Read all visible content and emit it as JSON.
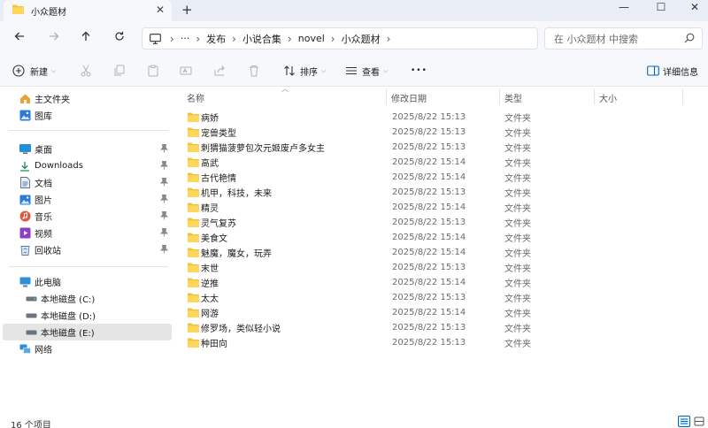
{
  "window": {
    "tab_title": "小众题材",
    "tab_close": "✕",
    "new_tab": "+",
    "minimize": "—",
    "maximize": "☐",
    "close": "✕"
  },
  "address": {
    "more": "···",
    "crumbs": [
      "发布",
      "小说合集",
      "novel",
      "小众题材"
    ],
    "separator": "›"
  },
  "search": {
    "placeholder": "在 小众题材 中搜索"
  },
  "toolbar": {
    "new_label": "新建",
    "sort_label": "排序",
    "view_label": "查看",
    "more_label": "•••",
    "details_label": "详细信息"
  },
  "sidebar": {
    "groups": [
      [
        {
          "label": "主文件夹",
          "icon": "home-icon"
        },
        {
          "label": "图库",
          "icon": "gallery-icon"
        }
      ],
      [
        {
          "label": "桌面",
          "icon": "desktop-icon",
          "pinned": true
        },
        {
          "label": "Downloads",
          "icon": "download-icon",
          "pinned": true
        },
        {
          "label": "文档",
          "icon": "documents-icon",
          "pinned": true
        },
        {
          "label": "图片",
          "icon": "pictures-icon",
          "pinned": true
        },
        {
          "label": "音乐",
          "icon": "music-icon",
          "pinned": true
        },
        {
          "label": "视频",
          "icon": "videos-icon",
          "pinned": true
        },
        {
          "label": "回收站",
          "icon": "recycle-bin-icon",
          "pinned": true
        }
      ],
      [
        {
          "label": "此电脑",
          "icon": "this-pc-icon"
        },
        {
          "label": "本地磁盘 (C:)",
          "icon": "drive-icon"
        },
        {
          "label": "本地磁盘 (D:)",
          "icon": "drive-icon"
        },
        {
          "label": "本地磁盘 (E:)",
          "icon": "drive-icon",
          "selected": true
        },
        {
          "label": "网络",
          "icon": "network-icon"
        }
      ]
    ]
  },
  "columns": {
    "name": "名称",
    "modified": "修改日期",
    "type": "类型",
    "size": "大小"
  },
  "files": [
    {
      "name": "病娇",
      "modified": "2025/8/22 15:13",
      "type": "文件夹"
    },
    {
      "name": "宠兽类型",
      "modified": "2025/8/22 15:13",
      "type": "文件夹"
    },
    {
      "name": "刺猬猫菠萝包次元姬废卢多女主",
      "modified": "2025/8/22 15:13",
      "type": "文件夹"
    },
    {
      "name": "高武",
      "modified": "2025/8/22 15:14",
      "type": "文件夹"
    },
    {
      "name": "古代艳情",
      "modified": "2025/8/22 15:14",
      "type": "文件夹"
    },
    {
      "name": "机甲，科技，未来",
      "modified": "2025/8/22 15:13",
      "type": "文件夹"
    },
    {
      "name": "精灵",
      "modified": "2025/8/22 15:14",
      "type": "文件夹"
    },
    {
      "name": "灵气复苏",
      "modified": "2025/8/22 15:13",
      "type": "文件夹"
    },
    {
      "name": "美食文",
      "modified": "2025/8/22 15:14",
      "type": "文件夹"
    },
    {
      "name": "魅魔，魔女，玩弄",
      "modified": "2025/8/22 15:14",
      "type": "文件夹"
    },
    {
      "name": "末世",
      "modified": "2025/8/22 15:13",
      "type": "文件夹"
    },
    {
      "name": "逆推",
      "modified": "2025/8/22 15:14",
      "type": "文件夹"
    },
    {
      "name": "太太",
      "modified": "2025/8/22 15:13",
      "type": "文件夹"
    },
    {
      "name": "网游",
      "modified": "2025/8/22 15:14",
      "type": "文件夹"
    },
    {
      "name": "修罗场，类似轻小说",
      "modified": "2025/8/22 15:13",
      "type": "文件夹"
    },
    {
      "name": "种田向",
      "modified": "2025/8/22 15:13",
      "type": "文件夹"
    }
  ],
  "status": {
    "item_count": "16 个项目"
  },
  "colors": {
    "folder": "#f3c13a",
    "accent": "#0067c0",
    "selected_bg": "#e5e5e5",
    "chrome_bg": "#f6f8fc"
  }
}
